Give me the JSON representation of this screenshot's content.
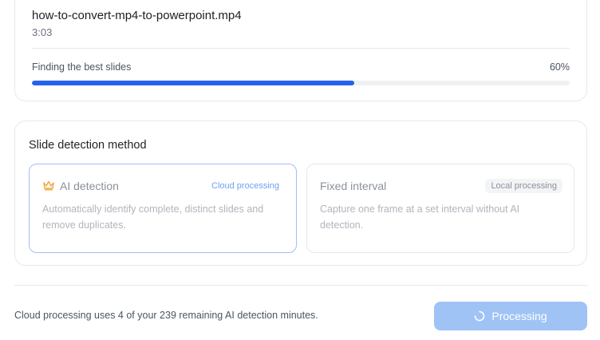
{
  "file": {
    "name": "how-to-convert-mp4-to-powerpoint.mp4",
    "duration": "3:03"
  },
  "progress": {
    "label": "Finding the best slides",
    "percent_text": "60%",
    "value": 0.6,
    "color": "#2563eb"
  },
  "method": {
    "title": "Slide detection method",
    "options": [
      {
        "icon": "crown-icon",
        "title": "AI detection",
        "badge": "Cloud processing",
        "description": "Automatically identify complete, distinct slides and remove duplicates.",
        "selected": true
      },
      {
        "title": "Fixed interval",
        "badge": "Local processing",
        "description": "Capture one frame at a set interval without AI detection.",
        "selected": false
      }
    ]
  },
  "footer": {
    "note": "Cloud processing uses 4 of your 239 remaining AI detection minutes.",
    "button_label": "Processing",
    "button_icon": "spinner-icon"
  }
}
